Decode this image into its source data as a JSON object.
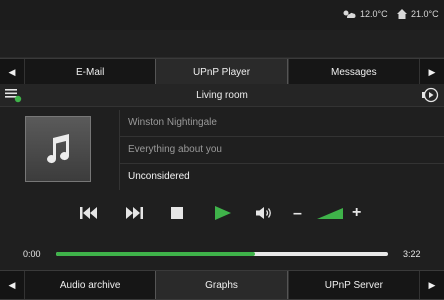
{
  "status": {
    "outside_temp": "12.0°C",
    "inside_temp": "21.0°C"
  },
  "top_tabs": {
    "left_arrow": "◀",
    "right_arrow": "▶",
    "items": [
      {
        "label": "E-Mail",
        "active": false
      },
      {
        "label": "UPnP Player",
        "active": true
      },
      {
        "label": "Messages",
        "active": false
      }
    ]
  },
  "room": {
    "name": "Living room",
    "left_icon": "playlist-icon",
    "right_icon": "output-icon"
  },
  "track": {
    "artist": "Winston Nightingale",
    "album": "Everything about you",
    "title": "Unconsidered"
  },
  "controls": {
    "buttons": [
      "previous-icon",
      "next-icon",
      "stop-icon",
      "play-icon",
      "volume-icon",
      "volume-down-icon",
      "volume-level-icon",
      "volume-up-icon"
    ],
    "volume_minus": "–",
    "volume_plus": "+",
    "volume_level": 0.6
  },
  "progress": {
    "elapsed": "0:00",
    "total": "3:22",
    "fraction": 0.6
  },
  "bottom_tabs": {
    "left_arrow": "◀",
    "right_arrow": "▶",
    "items": [
      {
        "label": "Audio archive",
        "active": false
      },
      {
        "label": "Graphs",
        "active": true
      },
      {
        "label": "UPnP Server",
        "active": false
      }
    ]
  },
  "colors": {
    "accent": "#3fb34a",
    "background": "#1f1f1f",
    "tab_active": "#2a2a2a"
  }
}
